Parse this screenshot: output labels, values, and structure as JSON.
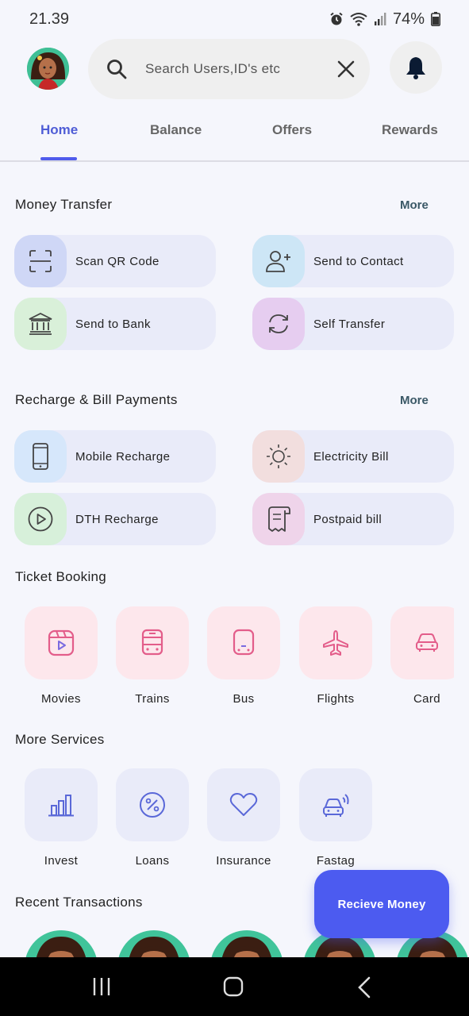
{
  "status_bar": {
    "time": "21.39",
    "battery": "74%"
  },
  "search": {
    "placeholder": "Search Users,ID's etc"
  },
  "tabs": [
    {
      "label": "Home",
      "active": true
    },
    {
      "label": "Balance",
      "active": false
    },
    {
      "label": "Offers",
      "active": false
    },
    {
      "label": "Rewards",
      "active": false
    }
  ],
  "money_transfer": {
    "title": "Money Transfer",
    "more": "More",
    "items": [
      {
        "label": "Scan QR Code",
        "icon": "scan-qr-icon",
        "color": "#cfd7f6"
      },
      {
        "label": "Send to Contact",
        "icon": "add-contact-icon",
        "color": "#cde6f6"
      },
      {
        "label": "Send to Bank",
        "icon": "bank-icon",
        "color": "#d9f0d9"
      },
      {
        "label": "Self Transfer",
        "icon": "refresh-icon",
        "color": "#e6cdf0"
      }
    ]
  },
  "recharge": {
    "title": "Recharge & Bill Payments",
    "more": "More",
    "items": [
      {
        "label": "Mobile Recharge",
        "icon": "mobile-icon",
        "color": "#d6e7fb"
      },
      {
        "label": "Electricity Bill",
        "icon": "sun-icon",
        "color": "#f2dede"
      },
      {
        "label": "DTH Recharge",
        "icon": "play-circle-icon",
        "color": "#d7f0da"
      },
      {
        "label": "Postpaid bill",
        "icon": "receipt-icon",
        "color": "#efd4ea"
      }
    ]
  },
  "ticket_booking": {
    "title": "Ticket Booking",
    "items": [
      {
        "label": "Movies",
        "icon": "movie-icon"
      },
      {
        "label": "Trains",
        "icon": "train-icon"
      },
      {
        "label": "Bus",
        "icon": "bus-icon"
      },
      {
        "label": "Flights",
        "icon": "airplane-icon"
      },
      {
        "label": "Card",
        "icon": "car-icon"
      }
    ]
  },
  "more_services": {
    "title": "More Services",
    "items": [
      {
        "label": "Invest",
        "icon": "bar-chart-icon"
      },
      {
        "label": "Loans",
        "icon": "percent-icon"
      },
      {
        "label": "Insurance",
        "icon": "heart-icon"
      },
      {
        "label": "Fastag",
        "icon": "car-signal-icon"
      }
    ]
  },
  "recent_transactions": {
    "title": "Recent Transactions"
  },
  "fab": {
    "label": "Recieve Money"
  },
  "colors": {
    "accent": "#4c5bf0",
    "pink_icon": "#e35d8a",
    "lav_icon": "#5a68d8",
    "more": "#3a5866"
  }
}
